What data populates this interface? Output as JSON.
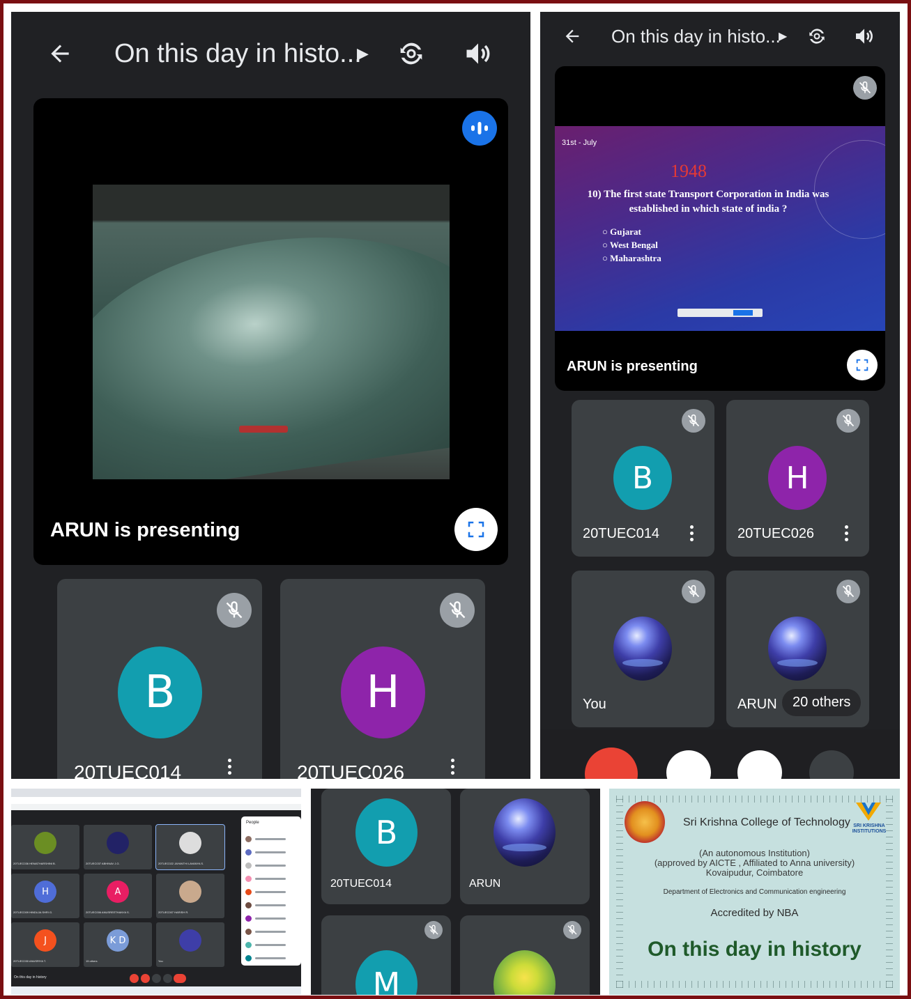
{
  "left_phone": {
    "title": "On this day in histo...",
    "presenting_text": "ARUN is presenting",
    "participants": [
      {
        "initial": "B",
        "name": "20TUEC014",
        "color": "#129eaf"
      },
      {
        "initial": "H",
        "name": "20TUEC026",
        "color": "#8e24aa"
      }
    ]
  },
  "right_phone": {
    "title": "On this day in histo...",
    "presenting_text": "ARUN is presenting",
    "slide": {
      "date": "31st - July",
      "year": "1948",
      "question": "10) The first state Transport Corporation in India was established in which state of india ?",
      "options": [
        "Gujarat",
        "West Bengal",
        "Maharashtra"
      ]
    },
    "participants": [
      {
        "initial": "B",
        "name": "20TUEC014",
        "color": "#129eaf"
      },
      {
        "initial": "H",
        "name": "20TUEC026",
        "color": "#8e24aa"
      },
      {
        "initial": "",
        "name": "You",
        "color": "#3e3ea8"
      },
      {
        "initial": "",
        "name": "ARUN",
        "color": "#3e3ea8"
      }
    ],
    "others_label": "20 others"
  },
  "desktop": {
    "tiles": [
      {
        "initial": "",
        "color": "#6b8e23",
        "name": "20TUEC036 HEMATHARSHINI B."
      },
      {
        "initial": "",
        "color": "#222266",
        "name": "20TUEC037 ABHINAV J.G."
      },
      {
        "initial": "",
        "color": "#dddddd",
        "name": "20TUEC022 JAYANTHI LAVANYA S."
      },
      {
        "initial": "H",
        "color": "#4f6dd8",
        "name": "20TUEC009 HINDUJA SHRI G."
      },
      {
        "initial": "A",
        "color": "#e91e63",
        "name": "20TUEC006 ANUSREETHANYA S."
      },
      {
        "initial": "",
        "color": "#c9a98d",
        "name": "20TUEC007 HARISH R."
      },
      {
        "initial": "J",
        "color": "#f4511e",
        "name": "20TUEC030 ANUSRIYA T."
      },
      {
        "initial": "K D",
        "color": "#7b9cd8",
        "name": "15 others"
      },
      {
        "initial": "",
        "color": "#3e3ea8",
        "name": "You"
      }
    ],
    "people_title": "People",
    "meeting_label": "On this day in history"
  },
  "small_grid": {
    "tiles": [
      {
        "initial": "B",
        "name": "20TUEC014",
        "color": "#129eaf"
      },
      {
        "initial": "",
        "name": "ARUN",
        "color": "#3e3ea8"
      },
      {
        "initial": "M",
        "name": "",
        "color": "#129eaf"
      },
      {
        "initial": "",
        "name": "",
        "color": "#7cb342"
      }
    ]
  },
  "certificate": {
    "college": "Sri Krishna College of Technology",
    "line1": "(An autonomous Institution)",
    "line2": "(approved by AICTE , Affiliated to Anna university)",
    "line3": "Kovaipudur, Coimbatore",
    "department": "Department of Electronics and Communication engineering",
    "accreditation": "Accredited by NBA",
    "headline": "On this day in history",
    "logo_text": "SRI KRISHNA INSTITUTIONS"
  }
}
